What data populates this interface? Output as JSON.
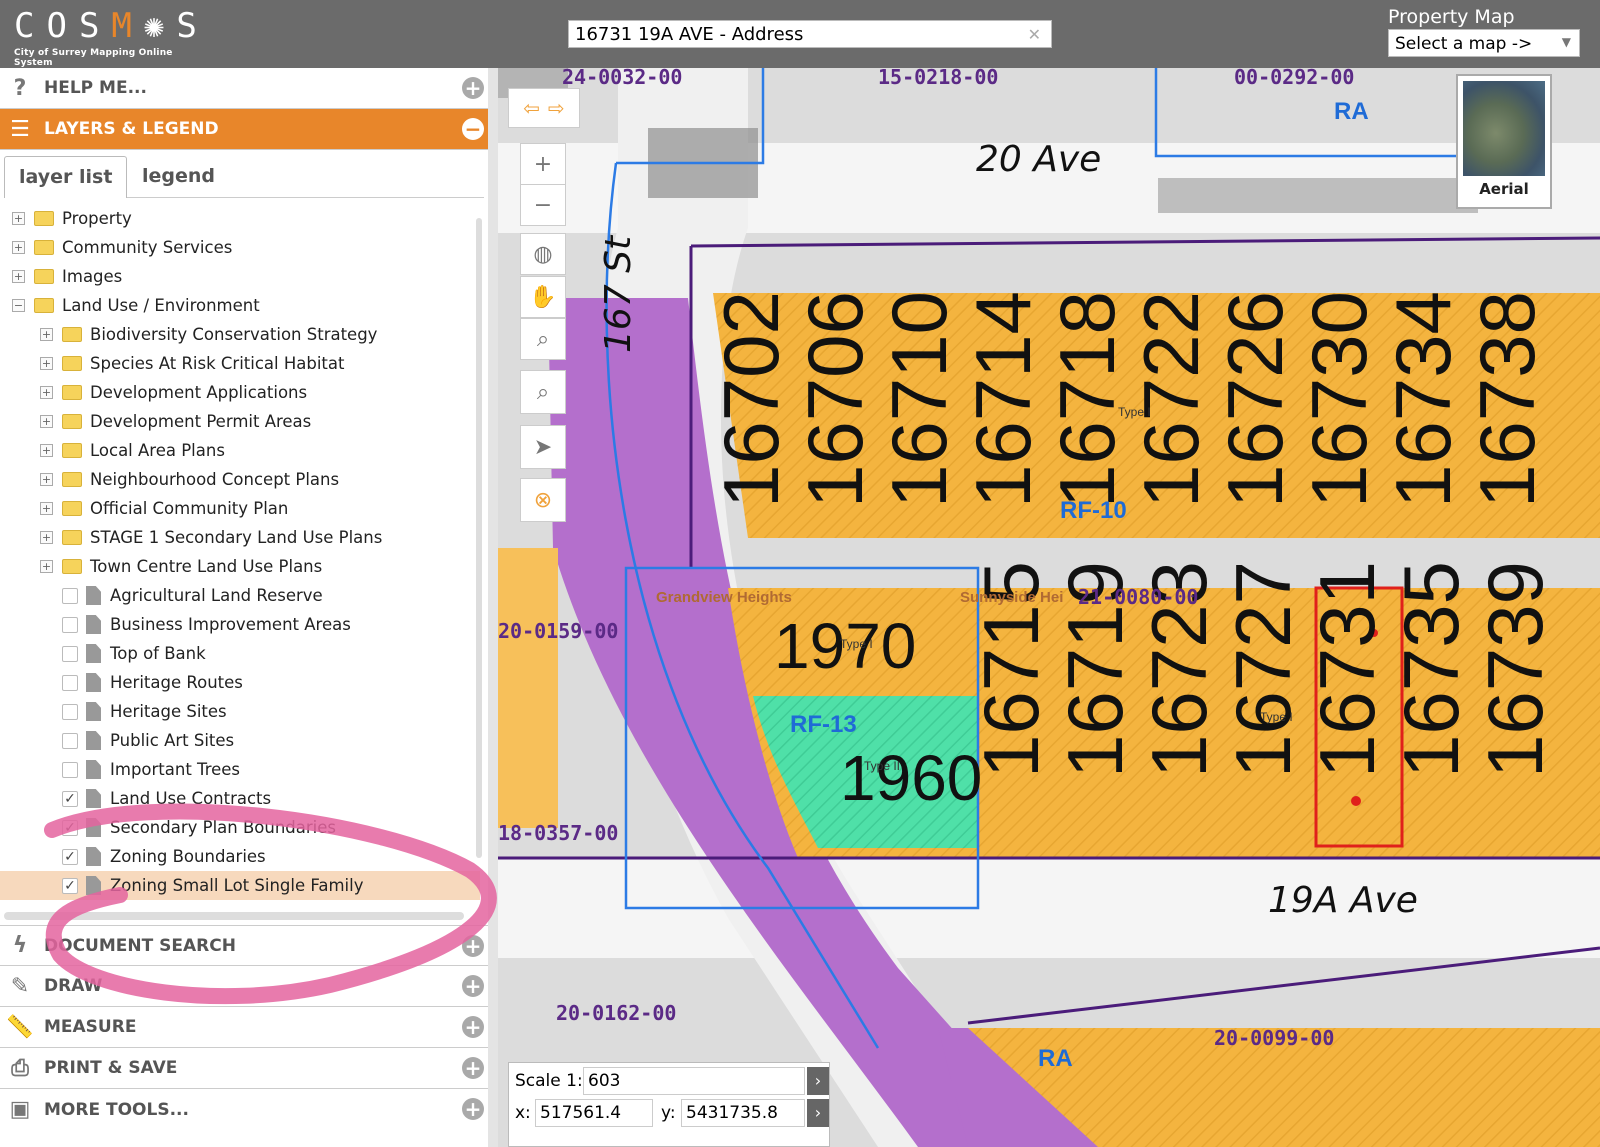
{
  "header": {
    "logo_text": "COSMOS",
    "logo_sub": "City of Surrey Mapping Online System",
    "search_value": "16731 19A AVE - Address",
    "property_map_label": "Property Map",
    "property_map_select": "Select a map ->"
  },
  "sidebar": {
    "sections": {
      "help": "HELP ME...",
      "layers": "LAYERS & LEGEND",
      "document_search": "DOCUMENT SEARCH",
      "draw": "DRAW",
      "measure": "MEASURE",
      "print": "PRINT & SAVE",
      "more": "MORE TOOLS..."
    },
    "tabs": {
      "layer_list": "layer list",
      "legend": "legend"
    },
    "tree": [
      {
        "label": "Property",
        "kind": "folder",
        "level": 0,
        "exp": "+"
      },
      {
        "label": "Community Services",
        "kind": "folder",
        "level": 0,
        "exp": "+"
      },
      {
        "label": "Images",
        "kind": "folder",
        "level": 0,
        "exp": "+"
      },
      {
        "label": "Land Use / Environment",
        "kind": "folder",
        "level": 0,
        "exp": "−"
      },
      {
        "label": "Biodiversity Conservation Strategy",
        "kind": "folder",
        "level": 1,
        "exp": "+"
      },
      {
        "label": "Species At Risk Critical Habitat",
        "kind": "folder",
        "level": 1,
        "exp": "+"
      },
      {
        "label": "Development Applications",
        "kind": "folder",
        "level": 1,
        "exp": "+"
      },
      {
        "label": "Development Permit Areas",
        "kind": "folder",
        "level": 1,
        "exp": "+"
      },
      {
        "label": "Local Area Plans",
        "kind": "folder",
        "level": 1,
        "exp": "+"
      },
      {
        "label": "Neighbourhood Concept Plans",
        "kind": "folder",
        "level": 1,
        "exp": "+"
      },
      {
        "label": "Official Community Plan",
        "kind": "folder",
        "level": 1,
        "exp": "+"
      },
      {
        "label": "STAGE 1 Secondary Land Use Plans",
        "kind": "folder",
        "level": 1,
        "exp": "+"
      },
      {
        "label": "Town Centre Land Use Plans",
        "kind": "folder",
        "level": 1,
        "exp": "+"
      },
      {
        "label": "Agricultural Land Reserve",
        "kind": "layer",
        "checked": false
      },
      {
        "label": "Business Improvement Areas",
        "kind": "layer",
        "checked": false
      },
      {
        "label": "Top of Bank",
        "kind": "layer",
        "checked": false
      },
      {
        "label": "Heritage Routes",
        "kind": "layer",
        "checked": false
      },
      {
        "label": "Heritage Sites",
        "kind": "layer",
        "checked": false
      },
      {
        "label": "Public Art Sites",
        "kind": "layer",
        "checked": false
      },
      {
        "label": "Important Trees",
        "kind": "layer",
        "checked": false
      },
      {
        "label": "Land Use Contracts",
        "kind": "layer",
        "checked": true
      },
      {
        "label": "Secondary Plan Boundaries",
        "kind": "layer",
        "checked": true
      },
      {
        "label": "Zoning Boundaries",
        "kind": "layer",
        "checked": true
      },
      {
        "label": "Zoning Small Lot Single Family",
        "kind": "layer",
        "checked": true,
        "highlight": true
      }
    ]
  },
  "map": {
    "streets": {
      "ave20": "20 Ave",
      "st167": "167 St",
      "ave19a": "19A Ave"
    },
    "lots_north": [
      "16702",
      "16706",
      "16710",
      "16714",
      "16718",
      "16722",
      "16726",
      "16730",
      "16734",
      "16738"
    ],
    "lots_south": [
      "16715",
      "16719",
      "16723",
      "16727",
      "16731",
      "16735",
      "16739"
    ],
    "lot_1970": "1970",
    "lot_1960": "1960",
    "zones": {
      "rf10": "RF-10",
      "rf13": "RF-13",
      "ra_top": "RA",
      "ra_bottom": "RA"
    },
    "type_labels": {
      "type1": "Type I",
      "type2": "Type I",
      "type3": "Type II",
      "type4": "Type I"
    },
    "neighbourhoods": {
      "grandview": "Grandview Heights",
      "sunnyside": "Sunnyside Hei"
    },
    "apps": {
      "a1": "24-0032-00",
      "a2": "15-0218-00",
      "a3": "00-0292-00",
      "a4": "20-0159-00",
      "a5": "21-0080-00",
      "a6": "18-0357-00",
      "a7": "20-0162-00",
      "a8": "20-0099-00"
    },
    "selected_lot": "16731",
    "aerial_label": "Aerial",
    "scale_label": "Scale 1:",
    "scale_value": "603",
    "x_label": "x:",
    "x_value": "517561.4",
    "y_label": "y:",
    "y_value": "5431735.8"
  },
  "colors": {
    "accent": "#e8862a",
    "header": "#6b6b6b",
    "zone_orange": "#f4b43f",
    "zone_purple": "#b46fcc",
    "zone_green": "#4fe0a8",
    "app_label": "#5b2a86",
    "zone_label": "#1f6bd6",
    "selection": "#e0201b",
    "annotation": "#e4649f"
  }
}
